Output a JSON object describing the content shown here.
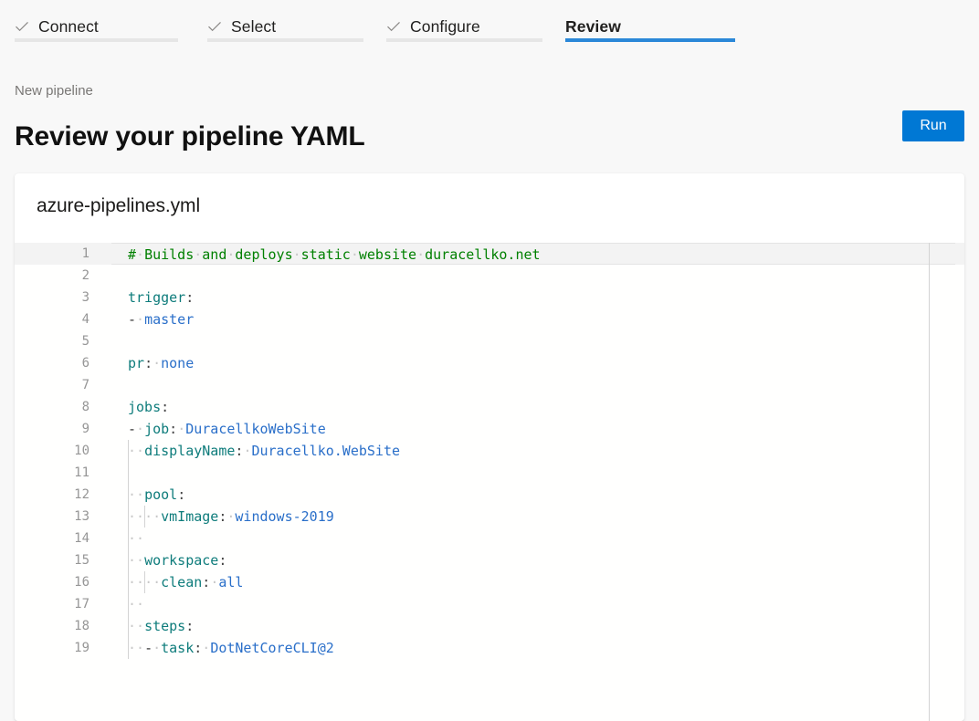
{
  "wizard": {
    "tabs": [
      {
        "label": "Connect",
        "icon": "check-icon",
        "completed": true,
        "active": false
      },
      {
        "label": "Select",
        "icon": "check-icon",
        "completed": true,
        "active": false
      },
      {
        "label": "Configure",
        "icon": "check-icon",
        "completed": true,
        "active": false
      },
      {
        "label": "Review",
        "icon": null,
        "completed": false,
        "active": true
      }
    ],
    "active_color": "#2b88d8",
    "inactive_color": "#e6e6e6"
  },
  "header": {
    "breadcrumb": "New pipeline",
    "title": "Review your pipeline YAML",
    "run_label": "Run",
    "run_color": "#0078d4"
  },
  "card": {
    "file_name": "azure-pipelines.yml"
  },
  "editor": {
    "language": "yaml",
    "current_line": 1,
    "total_lines_shown": 19,
    "ruler_column": 80,
    "colors": {
      "comment": "#008000",
      "key": "#0e7c7b",
      "value": "#2a6fc9",
      "line_number": "#969696",
      "current_line_bg": "#f3f3f3",
      "indent_guide": "#d3d3d3",
      "whitespace_dot": "#cfcfcf"
    },
    "lines": [
      {
        "no": "1",
        "guides": [],
        "tokens": [
          {
            "t": "# Builds and deploys static website duracellko.net",
            "c": "comment",
            "ws_dots": true
          }
        ]
      },
      {
        "no": "2",
        "guides": [],
        "tokens": []
      },
      {
        "no": "3",
        "guides": [],
        "tokens": [
          {
            "t": "trigger",
            "c": "key"
          },
          {
            "t": ":",
            "c": "punct"
          }
        ]
      },
      {
        "no": "4",
        "guides": [],
        "tokens": [
          {
            "t": "-",
            "c": "dash"
          },
          {
            "t": " ",
            "c": "ws"
          },
          {
            "t": "master",
            "c": "value"
          }
        ]
      },
      {
        "no": "5",
        "guides": [],
        "tokens": []
      },
      {
        "no": "6",
        "guides": [],
        "tokens": [
          {
            "t": "pr",
            "c": "key"
          },
          {
            "t": ":",
            "c": "punct"
          },
          {
            "t": " ",
            "c": "ws"
          },
          {
            "t": "none",
            "c": "value"
          }
        ]
      },
      {
        "no": "7",
        "guides": [],
        "tokens": []
      },
      {
        "no": "8",
        "guides": [],
        "tokens": [
          {
            "t": "jobs",
            "c": "key"
          },
          {
            "t": ":",
            "c": "punct"
          }
        ]
      },
      {
        "no": "9",
        "guides": [],
        "tokens": [
          {
            "t": "-",
            "c": "dash"
          },
          {
            "t": " ",
            "c": "ws"
          },
          {
            "t": "job",
            "c": "key"
          },
          {
            "t": ":",
            "c": "punct"
          },
          {
            "t": " ",
            "c": "ws"
          },
          {
            "t": "DuracellkoWebSite",
            "c": "value"
          }
        ]
      },
      {
        "no": "10",
        "guides": [
          0
        ],
        "tokens": [
          {
            "t": "  ",
            "c": "ws"
          },
          {
            "t": "displayName",
            "c": "key"
          },
          {
            "t": ":",
            "c": "punct"
          },
          {
            "t": " ",
            "c": "ws"
          },
          {
            "t": "Duracellko.WebSite",
            "c": "value"
          }
        ]
      },
      {
        "no": "11",
        "guides": [
          0
        ],
        "tokens": []
      },
      {
        "no": "12",
        "guides": [
          0
        ],
        "tokens": [
          {
            "t": "  ",
            "c": "ws"
          },
          {
            "t": "pool",
            "c": "key"
          },
          {
            "t": ":",
            "c": "punct"
          }
        ]
      },
      {
        "no": "13",
        "guides": [
          0,
          1
        ],
        "tokens": [
          {
            "t": "  ",
            "c": "ws"
          },
          {
            "t": "  ",
            "c": "ws"
          },
          {
            "t": "vmImage",
            "c": "key"
          },
          {
            "t": ":",
            "c": "punct"
          },
          {
            "t": " ",
            "c": "ws"
          },
          {
            "t": "windows-2019",
            "c": "value"
          }
        ]
      },
      {
        "no": "14",
        "guides": [
          0
        ],
        "tokens": [
          {
            "t": "  ",
            "c": "ws"
          }
        ]
      },
      {
        "no": "15",
        "guides": [
          0
        ],
        "tokens": [
          {
            "t": "  ",
            "c": "ws"
          },
          {
            "t": "workspace",
            "c": "key"
          },
          {
            "t": ":",
            "c": "punct"
          }
        ]
      },
      {
        "no": "16",
        "guides": [
          0,
          1
        ],
        "tokens": [
          {
            "t": "  ",
            "c": "ws"
          },
          {
            "t": "  ",
            "c": "ws"
          },
          {
            "t": "clean",
            "c": "key"
          },
          {
            "t": ":",
            "c": "punct"
          },
          {
            "t": " ",
            "c": "ws"
          },
          {
            "t": "all",
            "c": "value"
          }
        ]
      },
      {
        "no": "17",
        "guides": [
          0
        ],
        "tokens": [
          {
            "t": "  ",
            "c": "ws"
          }
        ]
      },
      {
        "no": "18",
        "guides": [
          0
        ],
        "tokens": [
          {
            "t": "  ",
            "c": "ws"
          },
          {
            "t": "steps",
            "c": "key"
          },
          {
            "t": ":",
            "c": "punct"
          }
        ]
      },
      {
        "no": "19",
        "guides": [
          0
        ],
        "tokens": [
          {
            "t": "  ",
            "c": "ws"
          },
          {
            "t": "-",
            "c": "dash"
          },
          {
            "t": " ",
            "c": "ws"
          },
          {
            "t": "task",
            "c": "key"
          },
          {
            "t": ":",
            "c": "punct"
          },
          {
            "t": " ",
            "c": "ws"
          },
          {
            "t": "DotNetCoreCLI@2",
            "c": "value"
          }
        ]
      }
    ]
  }
}
